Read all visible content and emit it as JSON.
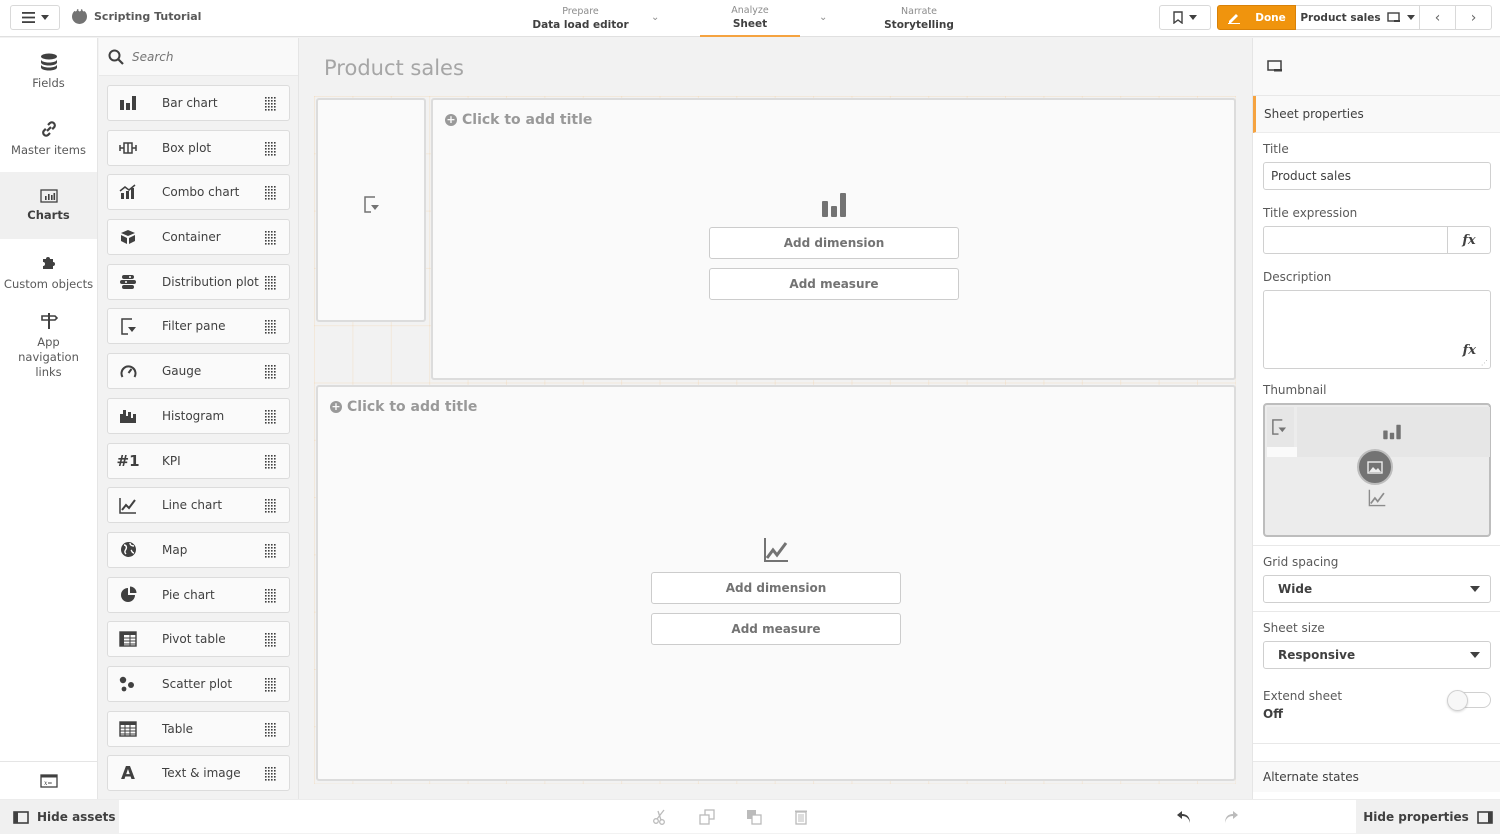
{
  "app": {
    "title": "Scripting Tutorial"
  },
  "nav": {
    "tabs": [
      {
        "sub": "Prepare",
        "main": "Data load editor",
        "active": false
      },
      {
        "sub": "Analyze",
        "main": "Sheet",
        "active": true
      },
      {
        "sub": "Narrate",
        "main": "Storytelling",
        "active": false
      }
    ]
  },
  "toolbar": {
    "done_label": "Done",
    "sheet_label": "Product sales"
  },
  "leftnav": {
    "items": [
      {
        "label": "Fields",
        "icon": "database-icon"
      },
      {
        "label": "Master items",
        "icon": "link-icon"
      },
      {
        "label": "Charts",
        "icon": "chart-icon",
        "active": true
      },
      {
        "label": "Custom objects",
        "icon": "puzzle-icon"
      },
      {
        "label": "App navigation links",
        "icon": "signpost-icon"
      }
    ]
  },
  "assets": {
    "search_placeholder": "Search",
    "items": [
      {
        "label": "Bar chart",
        "icon": "bar-chart-icon"
      },
      {
        "label": "Box plot",
        "icon": "box-plot-icon"
      },
      {
        "label": "Combo chart",
        "icon": "combo-chart-icon"
      },
      {
        "label": "Container",
        "icon": "container-icon"
      },
      {
        "label": "Distribution plot",
        "icon": "distribution-plot-icon"
      },
      {
        "label": "Filter pane",
        "icon": "filter-pane-icon"
      },
      {
        "label": "Gauge",
        "icon": "gauge-icon"
      },
      {
        "label": "Histogram",
        "icon": "histogram-icon"
      },
      {
        "label": "KPI",
        "icon": "kpi-icon"
      },
      {
        "label": "Line chart",
        "icon": "line-chart-icon"
      },
      {
        "label": "Map",
        "icon": "map-icon"
      },
      {
        "label": "Pie chart",
        "icon": "pie-chart-icon"
      },
      {
        "label": "Pivot table",
        "icon": "pivot-table-icon"
      },
      {
        "label": "Scatter plot",
        "icon": "scatter-plot-icon"
      },
      {
        "label": "Table",
        "icon": "table-icon"
      },
      {
        "label": "Text & image",
        "icon": "text-image-icon"
      }
    ]
  },
  "sheet": {
    "title": "Product sales",
    "objects": [
      {
        "type": "filter-pane"
      },
      {
        "type": "bar-chart",
        "title_placeholder": "Click to add title",
        "add_dimension": "Add dimension",
        "add_measure": "Add measure"
      },
      {
        "type": "line-chart",
        "title_placeholder": "Click to add title",
        "add_dimension": "Add dimension",
        "add_measure": "Add measure"
      }
    ]
  },
  "properties": {
    "section": "Sheet properties",
    "title_label": "Title",
    "title_value": "Product sales",
    "title_expression_label": "Title expression",
    "title_expression_value": "",
    "description_label": "Description",
    "description_value": "",
    "fx_label": "fx",
    "thumbnail_label": "Thumbnail",
    "grid_spacing_label": "Grid spacing",
    "grid_spacing_value": "Wide",
    "sheet_size_label": "Sheet size",
    "sheet_size_value": "Responsive",
    "extend_sheet_label": "Extend sheet",
    "extend_sheet_value": "Off",
    "alternate_states_label": "Alternate states"
  },
  "bottombar": {
    "hide_assets": "Hide assets",
    "hide_properties": "Hide properties"
  },
  "colors": {
    "accent": "#f0940d",
    "accent_underline": "#f5a340",
    "text": "#404040",
    "muted": "#999999"
  }
}
